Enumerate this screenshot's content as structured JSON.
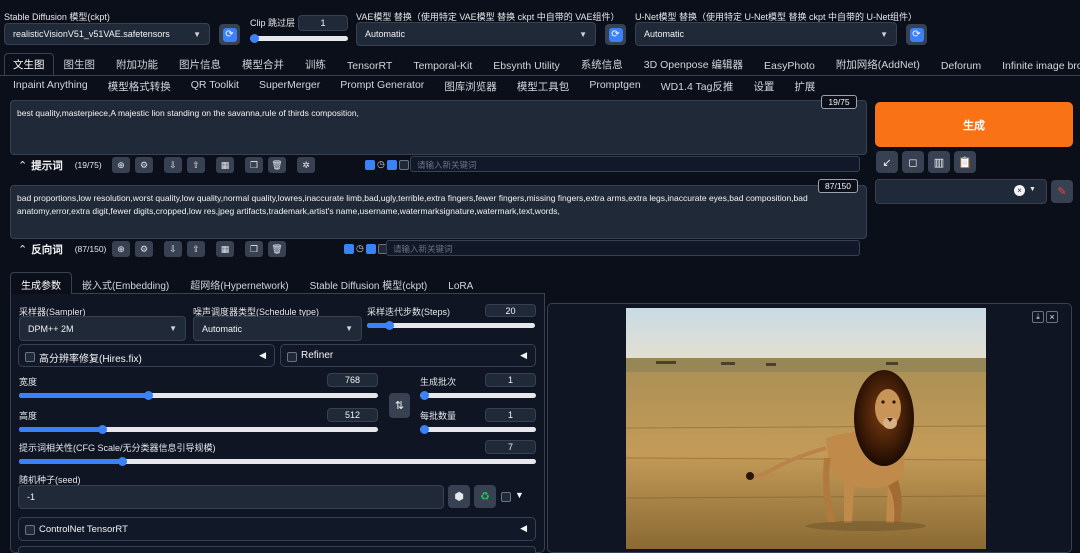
{
  "top": {
    "ckpt_label": "Stable Diffusion 模型(ckpt)",
    "ckpt_value": "realisticVisionV51_v51VAE.safetensors",
    "clip_label": "Clip 跳过层",
    "clip_value": "1",
    "vae_label": "VAE模型 替换（使用特定 VAE模型 替换 ckpt 中自带的 VAE组件）",
    "vae_value": "Automatic",
    "unet_label": "U-Net模型 替换（使用特定 U-Net模型 替换 ckpt 中自带的 U-Net组件）",
    "unet_value": "Automatic"
  },
  "tabs_row1": [
    "文生图",
    "图生图",
    "附加功能",
    "图片信息",
    "模型合并",
    "训练",
    "TensorRT",
    "Temporal-Kit",
    "Ebsynth Utility",
    "系统信息",
    "3D Openpose 编辑器",
    "EasyPhoto",
    "附加网络(AddNet)",
    "Deforum",
    "Infinite image browsing"
  ],
  "tabs_row2": [
    "Inpaint Anything",
    "模型格式转换",
    "QR Toolkit",
    "SuperMerger",
    "Prompt Generator",
    "图库浏览器",
    "模型工具包",
    "Promptgen",
    "WD1.4 Tag反推",
    "设置",
    "扩展"
  ],
  "prompt": {
    "text": "best quality,masterpiece,A majestic lion standing on the savanna,rule of thirds composition,",
    "counter": "19/75",
    "label": "提示词",
    "count": "(19/75)",
    "tag_placeholder": "请输入新关键词"
  },
  "negative": {
    "text": "bad proportions,low resolution,worst quality,low quality,normal quality,lowres,inaccurate limb,bad,ugly,terrible,extra fingers,fewer fingers,missing fingers,extra arms,extra legs,inaccurate eyes,bad composition,bad anatomy,error,extra digit,fewer digits,cropped,low res,jpeg artifacts,trademark,artist's name,username,watermarksignature,watermark,text,words,",
    "counter": "87/150",
    "label": "反向词",
    "count": "(87/150)",
    "tag_placeholder": "请输入新关键词"
  },
  "generate_label": "生成",
  "sub_tabs": [
    "生成参数",
    "嵌入式(Embedding)",
    "超网络(Hypernetwork)",
    "Stable Diffusion 模型(ckpt)",
    "LoRA"
  ],
  "params": {
    "sampler_label": "采样器(Sampler)",
    "sampler_value": "DPM++ 2M",
    "schedule_label": "噪声调度器类型(Schedule type)",
    "schedule_value": "Automatic",
    "steps_label": "采样迭代步数(Steps)",
    "steps_value": "20",
    "steps_fraction": 0.13,
    "hires_label": "高分辨率修复(Hires.fix)",
    "refiner_label": "Refiner",
    "width_label": "宽度",
    "width_value": "768",
    "width_fraction": 0.36,
    "height_label": "高度",
    "height_value": "512",
    "height_fraction": 0.23,
    "batch_count_label": "生成批次",
    "batch_count_value": "1",
    "batch_size_label": "每批数量",
    "batch_size_value": "1",
    "cfg_label": "提示词相关性(CFG Scale/无分类器信息引导规模)",
    "cfg_value": "7",
    "cfg_fraction": 0.2,
    "seed_label": "随机种子(seed)",
    "seed_value": "-1",
    "controlnet_label": "ControlNet TensorRT"
  },
  "colors": {
    "accent": "#3b82f6",
    "generate": "#f97316",
    "bg": "#0b0f19"
  }
}
